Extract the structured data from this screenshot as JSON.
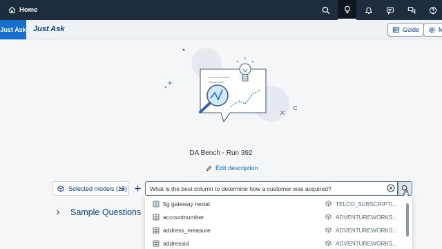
{
  "shell": {
    "home_label": "Home",
    "icons": [
      "search-icon",
      "lightbulb-icon",
      "bell-icon",
      "feedback-icon",
      "chat-icon",
      "help-icon"
    ]
  },
  "header": {
    "app_badge": "Just Ask",
    "title": "Just Ask",
    "guide_label": "Guide",
    "more_label": "M"
  },
  "main": {
    "run_title": "DA Bench - Run 392",
    "edit_description": "Edit description"
  },
  "query": {
    "models_label": "Selected models (15)",
    "text": "What is the best column to determine how a customer was acquired?"
  },
  "sample_questions": {
    "label": "Sample Questions"
  },
  "suggestions": [
    {
      "column": "5g gateway rental",
      "table": "TELCO_SUBSCRIPTI..."
    },
    {
      "column": "accountnumber",
      "table": "ADVENTUREWORKS..."
    },
    {
      "column": "address_measure",
      "table": "ADVENTUREWORKS..."
    },
    {
      "column": "addressid",
      "table": "ADVENTUREWORKS..."
    }
  ],
  "colors": {
    "shell_bg": "#1d2d3e",
    "accent": "#1b6fcc",
    "link": "#0a6ed1"
  }
}
